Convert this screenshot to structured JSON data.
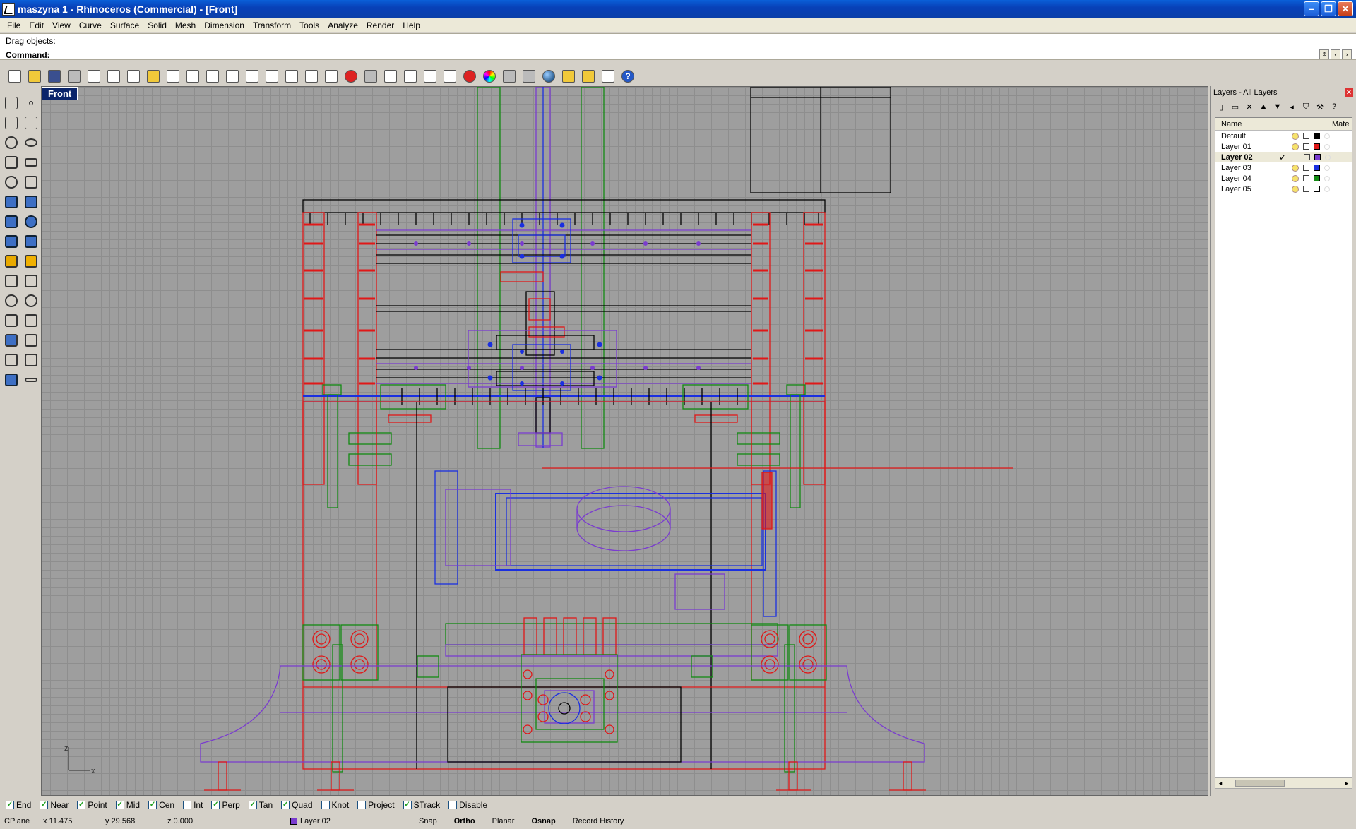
{
  "window": {
    "title": "maszyna 1 - Rhinoceros (Commercial) - [Front]"
  },
  "menu": [
    "File",
    "Edit",
    "View",
    "Curve",
    "Surface",
    "Solid",
    "Mesh",
    "Dimension",
    "Transform",
    "Tools",
    "Analyze",
    "Render",
    "Help"
  ],
  "command": {
    "history": "Drag objects:",
    "prompt": "Command:"
  },
  "viewport": {
    "label": "Front",
    "axis_x": "x",
    "axis_z": "z"
  },
  "layers_panel": {
    "title": "Layers - All Layers",
    "col_name": "Name",
    "col_material": "Mate",
    "rows": [
      {
        "name": "Default",
        "color": "#000000",
        "current": false
      },
      {
        "name": "Layer 01",
        "color": "#e01818",
        "current": false
      },
      {
        "name": "Layer 02",
        "color": "#7a3ccf",
        "current": true
      },
      {
        "name": "Layer 03",
        "color": "#1a2fe0",
        "current": false
      },
      {
        "name": "Layer 04",
        "color": "#128a12",
        "current": false
      },
      {
        "name": "Layer 05",
        "color": "#ffffff",
        "current": false
      }
    ],
    "current_mark": "✓"
  },
  "osnaps": [
    {
      "label": "End",
      "checked": true
    },
    {
      "label": "Near",
      "checked": true
    },
    {
      "label": "Point",
      "checked": true
    },
    {
      "label": "Mid",
      "checked": true
    },
    {
      "label": "Cen",
      "checked": true
    },
    {
      "label": "Int",
      "checked": false
    },
    {
      "label": "Perp",
      "checked": true
    },
    {
      "label": "Tan",
      "checked": true
    },
    {
      "label": "Quad",
      "checked": true
    },
    {
      "label": "Knot",
      "checked": false
    },
    {
      "label": "Project",
      "checked": false
    },
    {
      "label": "STrack",
      "checked": true
    },
    {
      "label": "Disable",
      "checked": false
    }
  ],
  "status": {
    "cplane": "CPlane",
    "x": "x 11.475",
    "y": "y 29.568",
    "z": "z 0.000",
    "layer": "Layer 02",
    "snap": "Snap",
    "ortho": "Ortho",
    "planar": "Planar",
    "osnap": "Osnap",
    "record_history": "Record History"
  },
  "colors": {
    "red": "#e01818",
    "blue": "#1a2fe0",
    "green": "#128a12",
    "purple": "#7a3ccf",
    "black": "#000000"
  }
}
